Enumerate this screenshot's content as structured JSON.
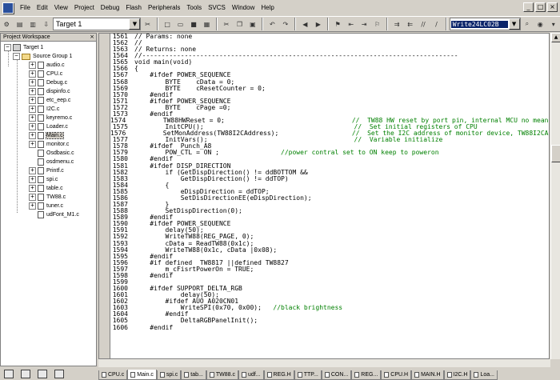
{
  "menubar": {
    "items": [
      "File",
      "Edit",
      "View",
      "Project",
      "Debug",
      "Flash",
      "Peripherals",
      "Tools",
      "SVCS",
      "Window",
      "Help"
    ],
    "window_controls": [
      "_",
      "□",
      "×"
    ]
  },
  "toolbar": {
    "target_label": "Target 1",
    "search_text": "Write24LC02B",
    "icons": [
      "compile-icon",
      "build-icon",
      "rebuild-icon",
      "stop-build-icon",
      "load-icon",
      "target-options-icon",
      "new-file-icon",
      "open-file-icon",
      "save-icon",
      "save-all-icon",
      "cut-icon",
      "copy-icon",
      "paste-icon",
      "undo-icon",
      "redo-icon",
      "prev-location-icon",
      "next-location-icon",
      "bookmark-icon",
      "prev-bookmark-icon",
      "next-bookmark-icon",
      "clear-bookmarks-icon",
      "indent-icon",
      "unindent-icon",
      "comment-icon",
      "uncomment-icon",
      "find-in-files-icon",
      "find-icon",
      "debug-start-icon",
      "breakpoint-icon",
      "window-config-icon"
    ]
  },
  "sidebar": {
    "title": "Project Workspace",
    "close": "×",
    "target": "Target 1",
    "group": "Source Group 1",
    "files": [
      "audio.c",
      "CPU.c",
      "Debug.c",
      "dispinfo.c",
      "etc_eep.c",
      "I2C.c",
      "keyremo.c",
      "Loader.c",
      "Main.c",
      "monitor.c",
      "Osdbasic.c",
      "osdmenu.c",
      "Printf.c",
      "spi.c",
      "table.c",
      "TW88.c",
      "tuner.c",
      "udFont_M1.c"
    ],
    "bottom_tabs": [
      "files-tab",
      "books-tab",
      "functions-tab",
      "templates-tab"
    ]
  },
  "editor": {
    "lines": [
      {
        "n": "1561",
        "t": "// Params: none",
        "c": true
      },
      {
        "n": "1562",
        "t": "//",
        "c": true
      },
      {
        "n": "1563",
        "t": "// Returns: none",
        "c": true
      },
      {
        "n": "1564",
        "t": "//----------------------------------------------------------------------------------",
        "c": true
      },
      {
        "n": "1565",
        "t": "void main(void)",
        "c": false
      },
      {
        "n": "1566",
        "t": "{",
        "c": false
      },
      {
        "n": "1567",
        "t": "    #ifdef POWER_SEQUENCE",
        "c": false
      },
      {
        "n": "1568",
        "t": "        BYTE    cData = 0;",
        "c": false
      },
      {
        "n": "1569",
        "t": "        BYTE    cResetCounter = 0;",
        "c": false
      },
      {
        "n": "1570",
        "t": "    #endif",
        "c": false
      },
      {
        "n": "1571",
        "t": "    #ifdef POWER_SEQUENCE",
        "c": false
      },
      {
        "n": "1572",
        "t": "        BYTE    cPage =0;",
        "c": false
      },
      {
        "n": "1573",
        "t": "    #endif",
        "c": false
      },
      {
        "n": "1574",
        "t": "        TW88HWReset = 0;                                 //  TW88 HW reset by port pin, internal MCU no meaning",
        "c": false
      },
      {
        "n": "1575",
        "t": "        InitCPU();                                       //  Set initial registers of CPU",
        "c": false
      },
      {
        "n": "1576",
        "t": "        SetMonAddress(TW88I2CAddress);                   //  Set the I2C address of monitor device, TW88I2CAddre",
        "c": false
      },
      {
        "n": "1577",
        "t": "        InitVars();                                      //  Variable initialize",
        "c": false
      },
      {
        "n": "1578",
        "t": "    #ifdef  Punch_A8",
        "c": false
      },
      {
        "n": "1579",
        "t": "        POW_CTL = ON ;                //power contral set to ON keep to poweron",
        "c": false
      },
      {
        "n": "1580",
        "t": "    #endif",
        "c": false
      },
      {
        "n": "1581",
        "t": "    #ifdef DISP_DIRECTION",
        "c": false
      },
      {
        "n": "1582",
        "t": "        if (GetDispDirection() != ddBOTTOM &&",
        "c": false
      },
      {
        "n": "1583",
        "t": "            GetDispDirection() != ddTOP)",
        "c": false
      },
      {
        "n": "1584",
        "t": "        {",
        "c": false
      },
      {
        "n": "1585",
        "t": "            eDispDirection = ddTOP;",
        "c": false
      },
      {
        "n": "1586",
        "t": "            SetDisDirectionEE(eDispDirection);",
        "c": false
      },
      {
        "n": "1587",
        "t": "        }",
        "c": false
      },
      {
        "n": "1588",
        "t": "        SetDispDirection(0);",
        "c": false
      },
      {
        "n": "1589",
        "t": "    #endif",
        "c": false
      },
      {
        "n": "1590",
        "t": "    #ifdef POWER_SEQUENCE",
        "c": false
      },
      {
        "n": "1591",
        "t": "        delay(50);",
        "c": false
      },
      {
        "n": "1592",
        "t": "        WriteTW88(REG_PAGE, 0);",
        "c": false
      },
      {
        "n": "1593",
        "t": "        cData = ReadTW88(0x1c);",
        "c": false
      },
      {
        "n": "1594",
        "t": "        WriteTW88(0x1c, cData |0x08);",
        "c": false
      },
      {
        "n": "1595",
        "t": "    #endif",
        "c": false
      },
      {
        "n": "1596",
        "t": "    #if defined  TW8817 ||defined TW8827",
        "c": false
      },
      {
        "n": "1597",
        "t": "        m_cFisrtPowerOn = TRUE;",
        "c": false
      },
      {
        "n": "1598",
        "t": "    #endif",
        "c": false
      },
      {
        "n": "1599",
        "t": "",
        "c": false
      },
      {
        "n": "1600",
        "t": "    #ifdef SUPPORT_DELTA_RGB",
        "c": false
      },
      {
        "n": "1601",
        "t": "            delay(50);",
        "c": false
      },
      {
        "n": "1602",
        "t": "        #ifdef AUO_A020CN01",
        "c": false
      },
      {
        "n": "1603",
        "t": "            WriteSPI(0x70, 0x00);   //black brightness",
        "c": false
      },
      {
        "n": "1604",
        "t": "        #endif",
        "c": false
      },
      {
        "n": "1605",
        "t": "            DeltaRGBPanelInit();",
        "c": false
      },
      {
        "n": "1606",
        "t": "    #endif",
        "c": false
      }
    ]
  },
  "file_tabs": [
    "CPU.c",
    "Main.c",
    "spi.c",
    "tab...",
    "TW88.c",
    "udf...",
    "REG.H",
    "TTP...",
    "CON...",
    "REG...",
    "CPU.H",
    "MAIN.H",
    "I2C.H",
    "Loa..."
  ]
}
